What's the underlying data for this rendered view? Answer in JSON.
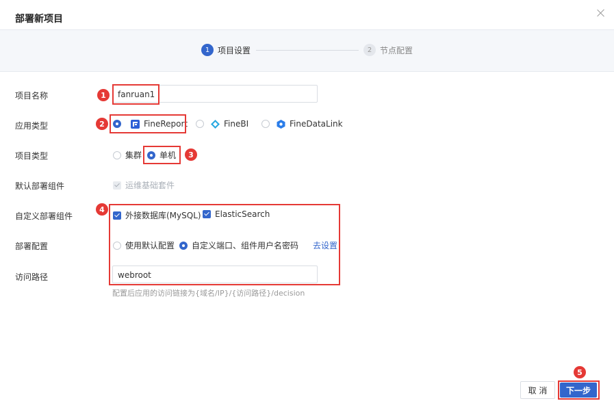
{
  "dialog": {
    "title": "部署新项目"
  },
  "steps": [
    {
      "num": "1",
      "label": "项目设置"
    },
    {
      "num": "2",
      "label": "节点配置"
    }
  ],
  "form": {
    "project_name": {
      "label": "项目名称",
      "value": "fanruan1"
    },
    "app_type": {
      "label": "应用类型",
      "options": [
        "FineReport",
        "FineBI",
        "FineDataLink"
      ],
      "selected": "FineReport"
    },
    "project_type": {
      "label": "项目类型",
      "options": [
        "集群",
        "单机"
      ],
      "selected": "单机"
    },
    "default_components": {
      "label": "默认部署组件",
      "item": "运维基础套件"
    },
    "custom_components": {
      "label": "自定义部署组件",
      "items": [
        "外接数据库(MySQL)",
        "ElasticSearch"
      ]
    },
    "deploy_config": {
      "label": "部署配置",
      "options": [
        "使用默认配置",
        "自定义端口、组件用户名密码"
      ],
      "selected": "自定义端口、组件用户名密码",
      "link": "去设置"
    },
    "access_path": {
      "label": "访问路径",
      "value": "webroot",
      "hint": "配置后应用的访问链接为{域名/IP}/{访问路径}/decision"
    }
  },
  "annotations": [
    "1",
    "2",
    "3",
    "4",
    "5"
  ],
  "buttons": {
    "cancel": "取 消",
    "next": "下一步"
  },
  "colors": {
    "accent": "#3366cc",
    "annotation": "#e53935"
  }
}
